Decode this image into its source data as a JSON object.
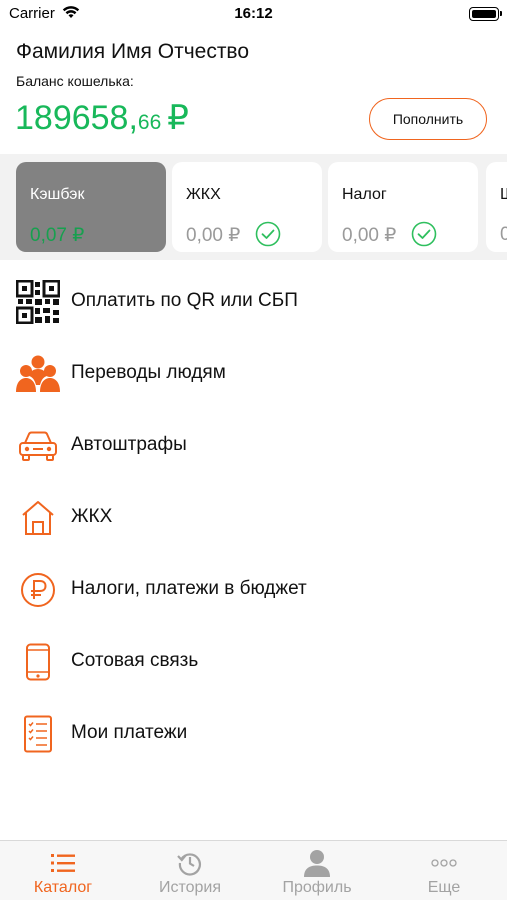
{
  "status_bar": {
    "carrier": "Carrier",
    "time": "16:12"
  },
  "header": {
    "user_name": "Фамилия Имя Отчество",
    "balance_label": "Баланс кошелька:",
    "balance_main": "189658,",
    "balance_cents": "66",
    "balance_currency": "₽",
    "topup_label": "Пополнить"
  },
  "cards": [
    {
      "title": "Кэшбэк",
      "value": "0,07 ₽"
    },
    {
      "title": "ЖКХ",
      "value": "0,00 ₽"
    },
    {
      "title": "Налог",
      "value": "0,00 ₽"
    },
    {
      "title": "Ш",
      "value": "0"
    }
  ],
  "menu": [
    {
      "label": "Оплатить по QR или СБП",
      "icon": "qr-code-icon"
    },
    {
      "label": "Переводы людям",
      "icon": "people-icon"
    },
    {
      "label": "Автоштрафы",
      "icon": "car-icon"
    },
    {
      "label": "ЖКХ",
      "icon": "house-icon"
    },
    {
      "label": "Налоги, платежи в бюджет",
      "icon": "ruble-circle-icon"
    },
    {
      "label": "Сотовая связь",
      "icon": "phone-icon"
    },
    {
      "label": "Мои платежи",
      "icon": "receipt-list-icon"
    }
  ],
  "tabbar": [
    {
      "label": "Каталог",
      "icon": "list-icon",
      "active": true
    },
    {
      "label": "История",
      "icon": "history-icon",
      "active": false
    },
    {
      "label": "Профиль",
      "icon": "profile-icon",
      "active": false
    },
    {
      "label": "Еще",
      "icon": "more-dots-icon",
      "active": false
    }
  ],
  "colors": {
    "accent": "#f0651f",
    "balance_green": "#18b85a",
    "check_green": "#2fbf5e",
    "inactive_gray": "#a3a3a3"
  }
}
